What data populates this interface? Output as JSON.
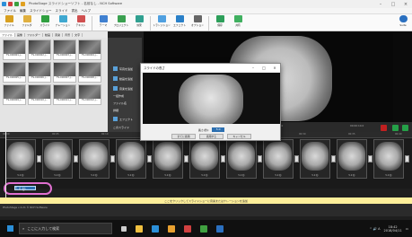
{
  "app": {
    "title": "PhotoStage スライドショーソフト - 名前なし - NCH Software",
    "qa_colors": [
      "#2b8fd8",
      "#d04040",
      "#3aa040",
      "#e0a020"
    ]
  },
  "menu": [
    "ファイル",
    "編集",
    "スライドショー",
    "スライド",
    "書出",
    "ヘルプ"
  ],
  "ribbon": [
    {
      "label": "ファイル",
      "color": "#d8a020"
    },
    {
      "label": "フォルダ",
      "color": "#e0b040"
    },
    {
      "label": "スライド",
      "color": "#30a040"
    },
    {
      "label": "ナレーション",
      "color": "#40a8d0"
    },
    {
      "label": "テキスト",
      "color": "#d05050"
    },
    {
      "label": "テーマ",
      "color": "#4080d0"
    },
    {
      "label": "プロジェクト",
      "color": "#3aa050"
    },
    {
      "label": "効果",
      "color": "#30a090"
    },
    {
      "label": "トランジション",
      "color": "#50a0e0"
    },
    {
      "label": "エフェクト",
      "color": "#2a80c8"
    },
    {
      "label": "オプション",
      "color": "#666666"
    },
    {
      "label": "保存",
      "color": "#2d9f5a"
    },
    {
      "label": "共有",
      "color": "#40b060"
    },
    {
      "label": "Suite",
      "color": "#2b70c0"
    }
  ],
  "library": {
    "tabs": [
      "ファイル",
      "画像",
      "フォルダー",
      "動画",
      "音楽",
      "背景",
      "文字"
    ],
    "items": [
      "TS-000001.j…",
      "TS-000002.j…",
      "TS-000003.j…",
      "TS-000004.j…",
      "TS-000005.j…",
      "TS-000006.j…",
      "TS-000007.j…",
      "TS-000008.j…",
      "TS-000009.j…",
      "TS-000010.j…",
      "TS-000011.j…",
      "TS-000012.j…"
    ]
  },
  "side": [
    "写真を追加",
    "動画を追加",
    "音楽を追加",
    "一括作成",
    "ファイル名",
    "詳細",
    "エフェクト",
    "このスライド"
  ],
  "wave": {
    "left": "00:00:00.0",
    "mid": "00:00:05.0",
    "right": "00:00:10.0"
  },
  "ruler": [
    "00:00",
    "00:05",
    "00:10",
    "00:15",
    "00:20",
    "00:25",
    "00:30",
    "00:35",
    "00:40"
  ],
  "clips": [
    "5.0 秒",
    "5.0 秒",
    "5.0 秒",
    "5.0 秒",
    "5.0 秒",
    "5.0 秒",
    "5.0 秒",
    "5.0 秒",
    "5.0 秒",
    "5.0 秒",
    "5.0 秒",
    "5.0 秒",
    "5.0 秒"
  ],
  "selected_value": "5.0 秒",
  "message": "ここをクリックしてスライドショーに音楽またはナレーションを追加",
  "status": "PhotoStage v 4.21 © NCH Software",
  "dialog": {
    "title": "スライドの長さ",
    "duration_label": "長さ(秒):",
    "duration_value": "5.0",
    "buttons": [
      "全てに適用",
      "適用する",
      "キャンセル"
    ]
  },
  "taskbar": {
    "search_placeholder": "ここに入力して検索",
    "tray": "^ 🔊 A",
    "time": "18:42",
    "date": "2018/04/11",
    "icon_colors": [
      "#f0c040",
      "#2b8fd8",
      "#e8a030",
      "#d04040",
      "#40a040",
      "#2b70c0"
    ]
  }
}
